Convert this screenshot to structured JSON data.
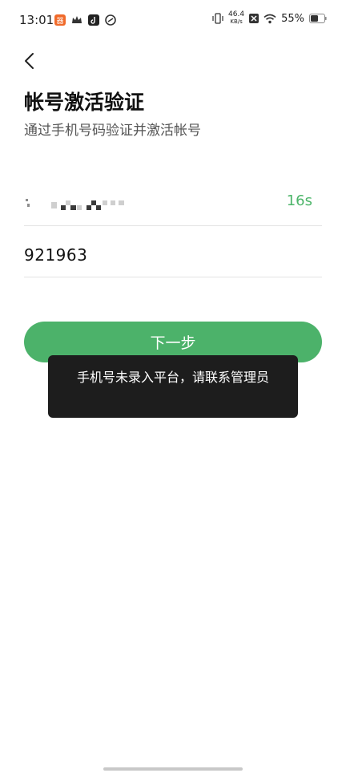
{
  "status_bar": {
    "time": "13:01",
    "net_speed": "46.4",
    "net_unit": "KB/s",
    "battery": "55%"
  },
  "page": {
    "title": "帐号激活验证",
    "subtitle": "通过手机号码验证并激活帐号"
  },
  "form": {
    "phone_masked": true,
    "countdown": "16s",
    "code_value": "921963",
    "next_label": "下一步"
  },
  "toast": {
    "message": "手机号未录入平台，请联系管理员"
  },
  "colors": {
    "accent": "#4cb26a",
    "countdown": "#4db56a",
    "toast_bg": "#1d1d1d"
  }
}
